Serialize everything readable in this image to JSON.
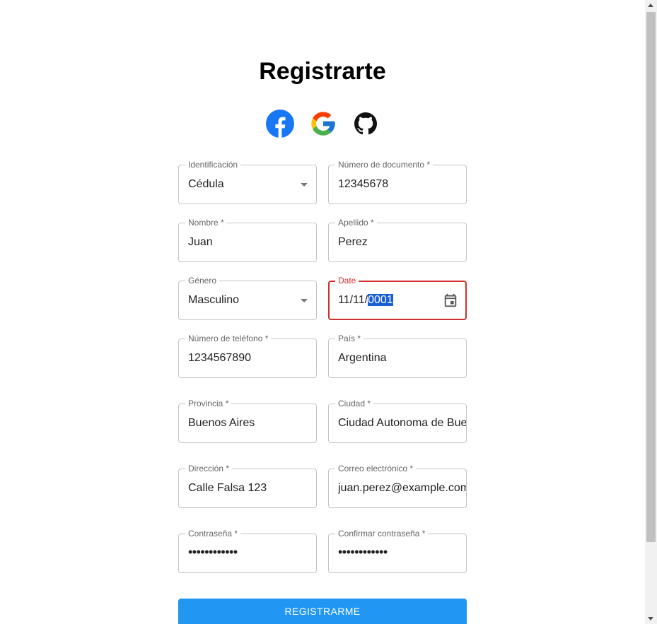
{
  "form": {
    "title": "Registrarte",
    "social": [
      "facebook-icon",
      "google-icon",
      "github-icon"
    ],
    "identificacion": {
      "label": "Identificación",
      "value": "Cédula"
    },
    "numero_documento": {
      "label": "Número de documento *",
      "value": "12345678"
    },
    "nombre": {
      "label": "Nombre *",
      "value": "Juan"
    },
    "apellido": {
      "label": "Apellido *",
      "value": "Perez"
    },
    "genero": {
      "label": "Género",
      "value": "Masculino"
    },
    "date": {
      "label": "Date",
      "value_prefix": "11/11/",
      "value_selected": "0001"
    },
    "telefono": {
      "label": "Número de teléfono *",
      "value": "1234567890"
    },
    "pais": {
      "label": "País *",
      "value": "Argentina"
    },
    "provincia": {
      "label": "Provincia *",
      "value": "Buenos Aires"
    },
    "ciudad": {
      "label": "Ciudad *",
      "value": "Ciudad Autonoma de Buenos Aires"
    },
    "direccion": {
      "label": "Dirección *",
      "value": "Calle Falsa 123"
    },
    "correo": {
      "label": "Correo electrónico *",
      "value": "juan.perez@example.com"
    },
    "contrasena": {
      "label": "Contraseña *",
      "value": "••••••••••••"
    },
    "confirmar": {
      "label": "Confirmar contraseña *",
      "value": "••••••••••••"
    },
    "submit_label": "REGISTRARME"
  },
  "colors": {
    "primary": "#2196f3",
    "error": "#d32f2f",
    "selection": "#1a5fd1",
    "facebook": "#1877f2"
  }
}
